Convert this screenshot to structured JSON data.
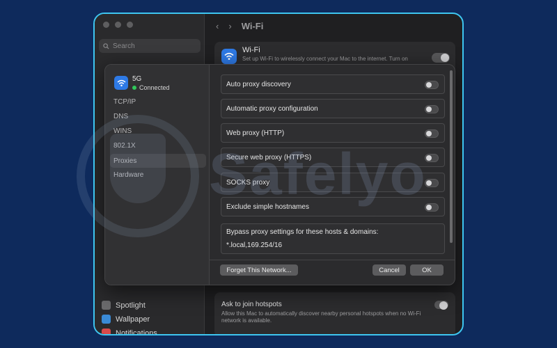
{
  "colors": {
    "page_background": "#0e2a5c",
    "frame_border": "#3ec6f0",
    "accent": "#2e7ae6",
    "connected_dot": "#30c85a"
  },
  "background_window": {
    "search_placeholder": "Search",
    "nav_back_icon": "chevron-left-icon",
    "nav_forward_icon": "chevron-right-icon",
    "title": "Wi-Fi",
    "wifi_row": {
      "title": "Wi-Fi",
      "description": "Set up Wi-Fi to wirelessly connect your Mac to the internet. Turn on Wi-Fi, then choose a network to join."
    },
    "sidebar_items": [
      "Spotlight",
      "Wallpaper",
      "Notifications"
    ],
    "hotspot_row": {
      "title": "Ask to join hotspots",
      "description": "Allow this Mac to automatically discover nearby personal hotspots when no Wi-Fi network is available."
    }
  },
  "sheet": {
    "network": {
      "name": "5G",
      "status": "Connected"
    },
    "sidebar": [
      "TCP/IP",
      "DNS",
      "WINS",
      "802.1X",
      "Proxies",
      "Hardware"
    ],
    "active_tab": "Proxies",
    "proxy_options": [
      {
        "label": "Auto proxy discovery",
        "enabled": false
      },
      {
        "label": "Automatic proxy configuration",
        "enabled": false
      },
      {
        "label": "Web proxy (HTTP)",
        "enabled": false
      },
      {
        "label": "Secure web proxy (HTTPS)",
        "enabled": false
      },
      {
        "label": "SOCKS proxy",
        "enabled": false
      },
      {
        "label": "Exclude simple hostnames",
        "enabled": false
      }
    ],
    "bypass": {
      "label": "Bypass proxy settings for these hosts & domains:",
      "value": "*.local,169.254/16"
    },
    "buttons": {
      "forget": "Forget This Network...",
      "cancel": "Cancel",
      "ok": "OK"
    }
  },
  "watermark": "Safelyo"
}
